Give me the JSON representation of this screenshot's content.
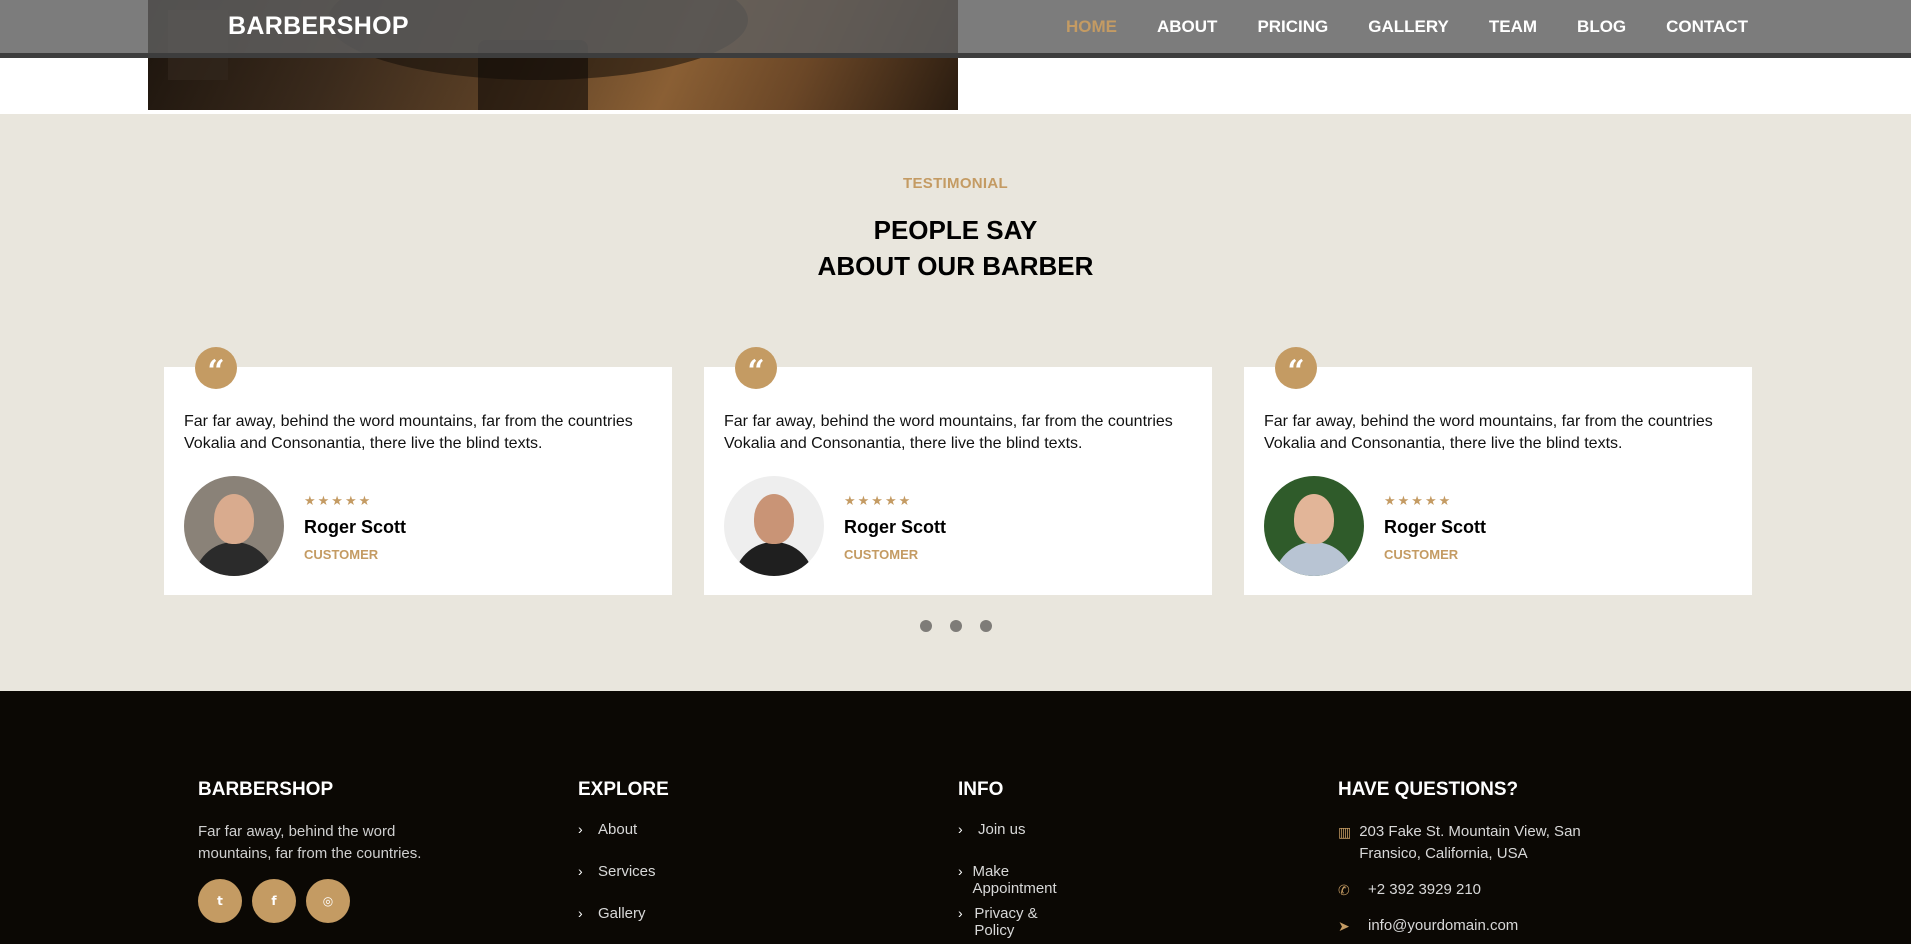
{
  "brand": "BARBERSHOP",
  "nav": {
    "items": [
      "HOME",
      "ABOUT",
      "PRICING",
      "GALLERY",
      "TEAM",
      "BLOG",
      "CONTACT"
    ],
    "active": "HOME"
  },
  "testimonial": {
    "subheading": "TESTIMONIAL",
    "heading_line1": "PEOPLE SAY",
    "heading_line2": "ABOUT OUR BARBER",
    "cards": [
      {
        "quote_mark": "“",
        "text": "Far far away, behind the word mountains, far from the countries Vokalia and Consonantia, there live the blind texts.",
        "stars": "★★★★★",
        "name": "Roger Scott",
        "role": "CUSTOMER"
      },
      {
        "quote_mark": "“",
        "text": "Far far away, behind the word mountains, far from the countries Vokalia and Consonantia, there live the blind texts.",
        "stars": "★★★★★",
        "name": "Roger Scott",
        "role": "CUSTOMER"
      },
      {
        "quote_mark": "“",
        "text": "Far far away, behind the word mountains, far from the countries Vokalia and Consonantia, there live the blind texts.",
        "stars": "★★★★★",
        "name": "Roger Scott",
        "role": "CUSTOMER"
      }
    ],
    "dots": 3
  },
  "footer": {
    "about": {
      "heading": "BARBERSHOP",
      "text": "Far far away, behind the word mountains, far from the countries.",
      "social": [
        "twitter-icon",
        "facebook-icon",
        "instagram-icon"
      ]
    },
    "explore": {
      "heading": "EXPLORE",
      "links": [
        "About",
        "Services",
        "Gallery"
      ]
    },
    "info": {
      "heading": "INFO",
      "links": [
        "Join us",
        "Make Appointment",
        "Privacy & Policy"
      ]
    },
    "questions": {
      "heading": "HAVE QUESTIONS?",
      "address": "203 Fake St. Mountain View, San Fransico, California, USA",
      "phone": "+2 392 3929 210",
      "email": "info@yourdomain.com"
    }
  },
  "colors": {
    "accent": "#c49b63",
    "section_bg": "#e9e6dd",
    "footer_bg": "#0b0804"
  }
}
